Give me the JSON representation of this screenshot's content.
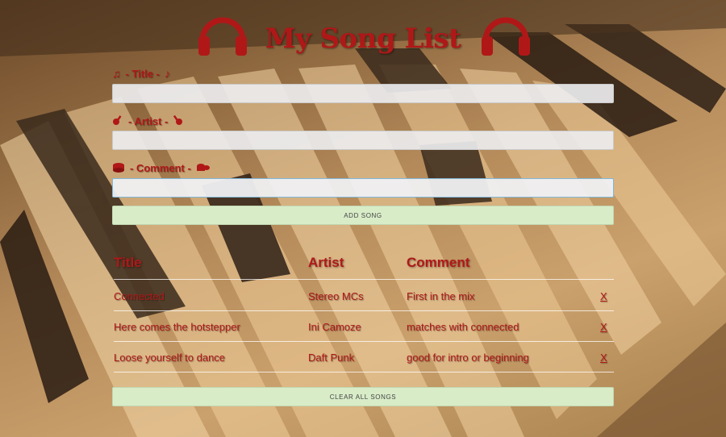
{
  "app": {
    "title": "My Song List"
  },
  "form": {
    "title_label": "- Title -",
    "artist_label": "- Artist -",
    "comment_label": "- Comment -",
    "title_value": "",
    "artist_value": "",
    "comment_value": "",
    "add_button": "ADD SONG"
  },
  "table": {
    "headers": [
      "Title",
      "Artist",
      "Comment"
    ],
    "rows": [
      {
        "title": "Connected",
        "artist": "Stereo MCs",
        "comment": "First in the mix",
        "delete": "X"
      },
      {
        "title": "Here comes the hotstepper",
        "artist": "Ini Camoze",
        "comment": "matches with connected",
        "delete": "X"
      },
      {
        "title": "Loose yourself to dance",
        "artist": "Daft Punk",
        "comment": "good for intro or beginning",
        "delete": "X"
      }
    ]
  },
  "clear_button": "CLEAR ALL SONGS",
  "colors": {
    "accent": "#b01818",
    "button_bg": "#d8ecc8",
    "input_bg": "#ececee"
  },
  "icons": [
    "headphones-icon",
    "music-note-icon",
    "guitar-icon",
    "drum-icon"
  ]
}
